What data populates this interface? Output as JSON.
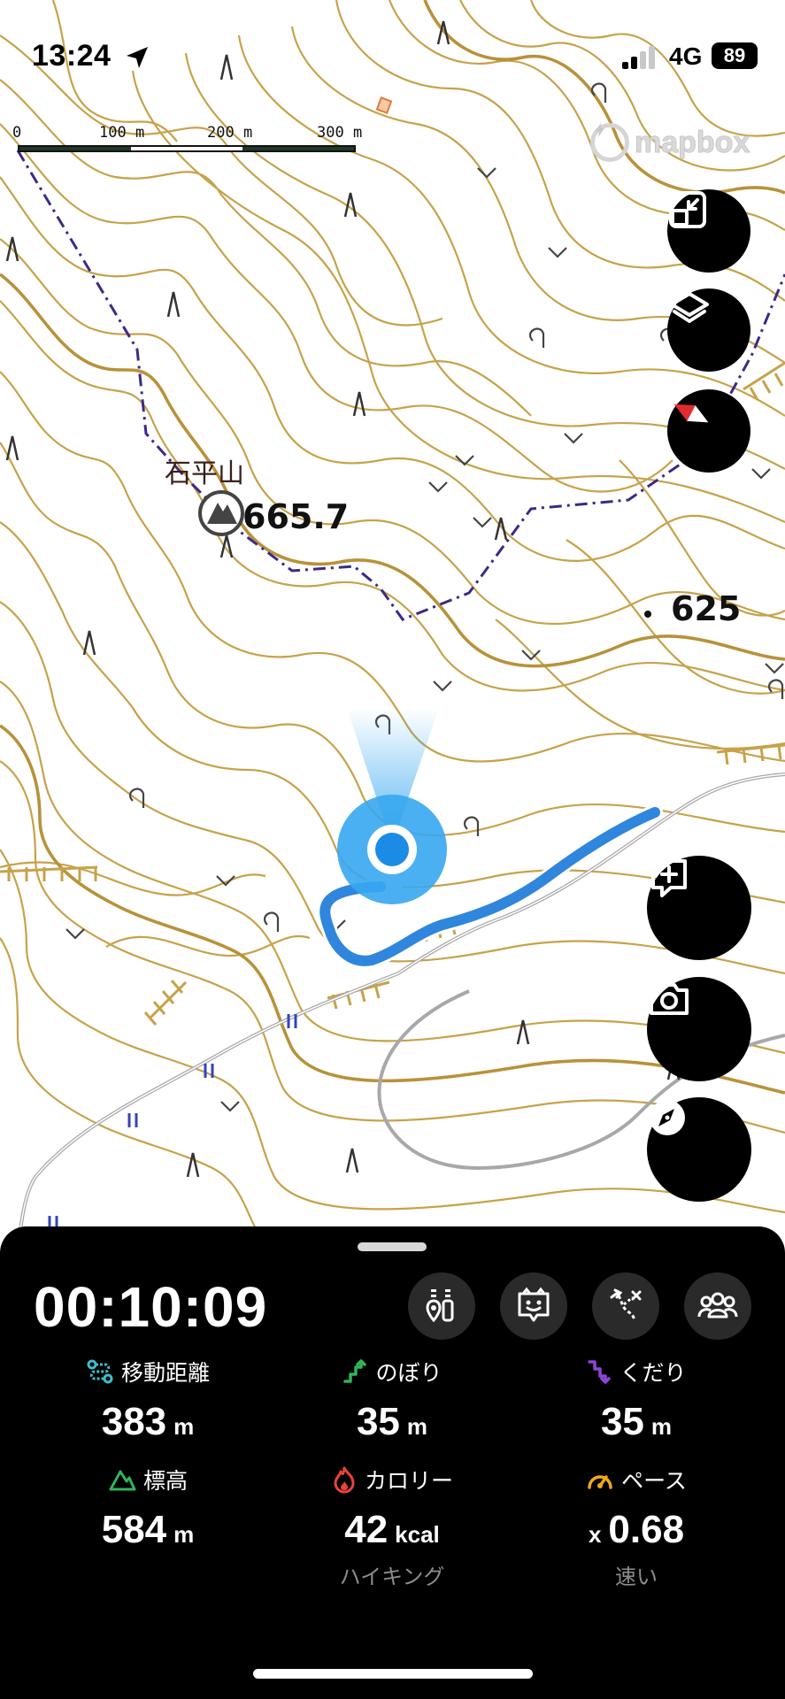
{
  "status_bar": {
    "time": "13:24",
    "location_icon": "location-arrow-icon",
    "network": "4G",
    "battery": "89"
  },
  "map": {
    "scale": {
      "labels": [
        "0",
        "100 m",
        "200 m",
        "300 m"
      ]
    },
    "attribution": "mapbox",
    "summit": {
      "name": "石平山",
      "elevation": "665.7"
    },
    "spot_height": "625",
    "colors": {
      "contour": "#c7a24a",
      "boundary": "#3b2a86",
      "track": "#2f86dc",
      "location": "#37a7ef",
      "road": "#a8a8a8",
      "water": "#3344bb"
    }
  },
  "controls": {
    "exit_fullscreen": "exit-fullscreen-icon",
    "layers": "layers-icon",
    "north_up": "compass-north-icon",
    "add_note": "add-note-icon",
    "camera": "camera-icon",
    "compass": "compass-icon"
  },
  "activity": {
    "elapsed": "00:10:09",
    "tools": [
      "checkpoint-icon",
      "face-icon",
      "route-icon",
      "group-icon"
    ],
    "stats": [
      {
        "label": "移動距離",
        "value": "383",
        "unit": "m",
        "icon": "distance-icon",
        "color": "#3cbcc9"
      },
      {
        "label": "のぼり",
        "value": "35",
        "unit": "m",
        "icon": "ascent-icon",
        "color": "#2fb45a"
      },
      {
        "label": "くだり",
        "value": "35",
        "unit": "m",
        "icon": "descent-icon",
        "color": "#8e44d8"
      },
      {
        "label": "標高",
        "value": "584",
        "unit": "m",
        "icon": "mountain-icon",
        "color": "#2fb45a"
      },
      {
        "label": "カロリー",
        "value": "42",
        "unit": "kcal",
        "icon": "flame-icon",
        "color": "#e8433a",
        "sub": "ハイキング"
      },
      {
        "label": "ペース",
        "value": "0.68",
        "prefix": "x",
        "icon": "speedometer-icon",
        "color": "#f0a818",
        "sub": "速い"
      }
    ]
  }
}
